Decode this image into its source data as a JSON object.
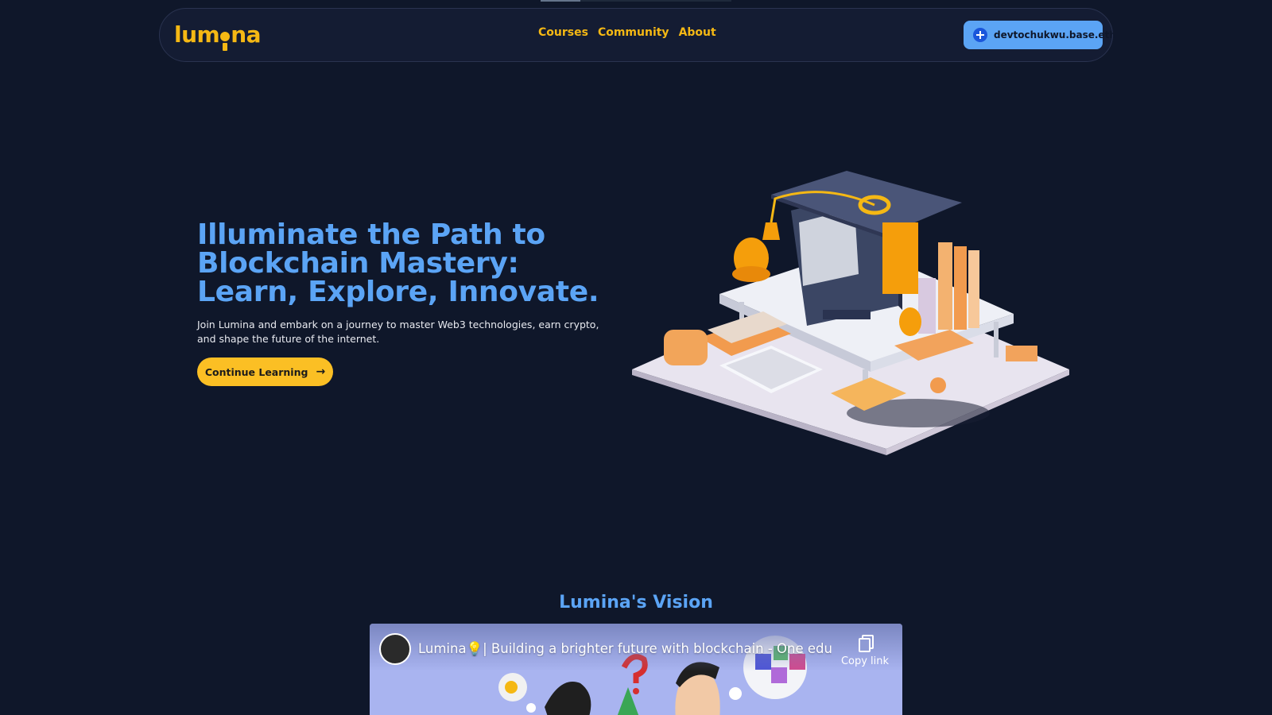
{
  "nav": {
    "logo_text": "lumina",
    "links": [
      {
        "label": "Courses"
      },
      {
        "label": "Community"
      },
      {
        "label": "About"
      }
    ],
    "wallet_label": "devtochukwu.base.eth"
  },
  "hero": {
    "title": "Illuminate the Path to Blockchain Mastery: Learn, Explore, Innovate.",
    "subtitle": "Join Lumina and embark on a journey to master Web3 technologies, earn crypto, and shape the future of the internet.",
    "cta_label": "Continue Learning"
  },
  "vision": {
    "heading": "Lumina's Vision",
    "video": {
      "title": "Lumina💡| Building a brighter future with blockchain - One educ...",
      "copy_link_label": "Copy link"
    }
  },
  "colors": {
    "background": "#0f172a",
    "accent_yellow": "#fbbf24",
    "accent_blue": "#5ba4f5",
    "wallet_button": "#5ba4f5"
  }
}
